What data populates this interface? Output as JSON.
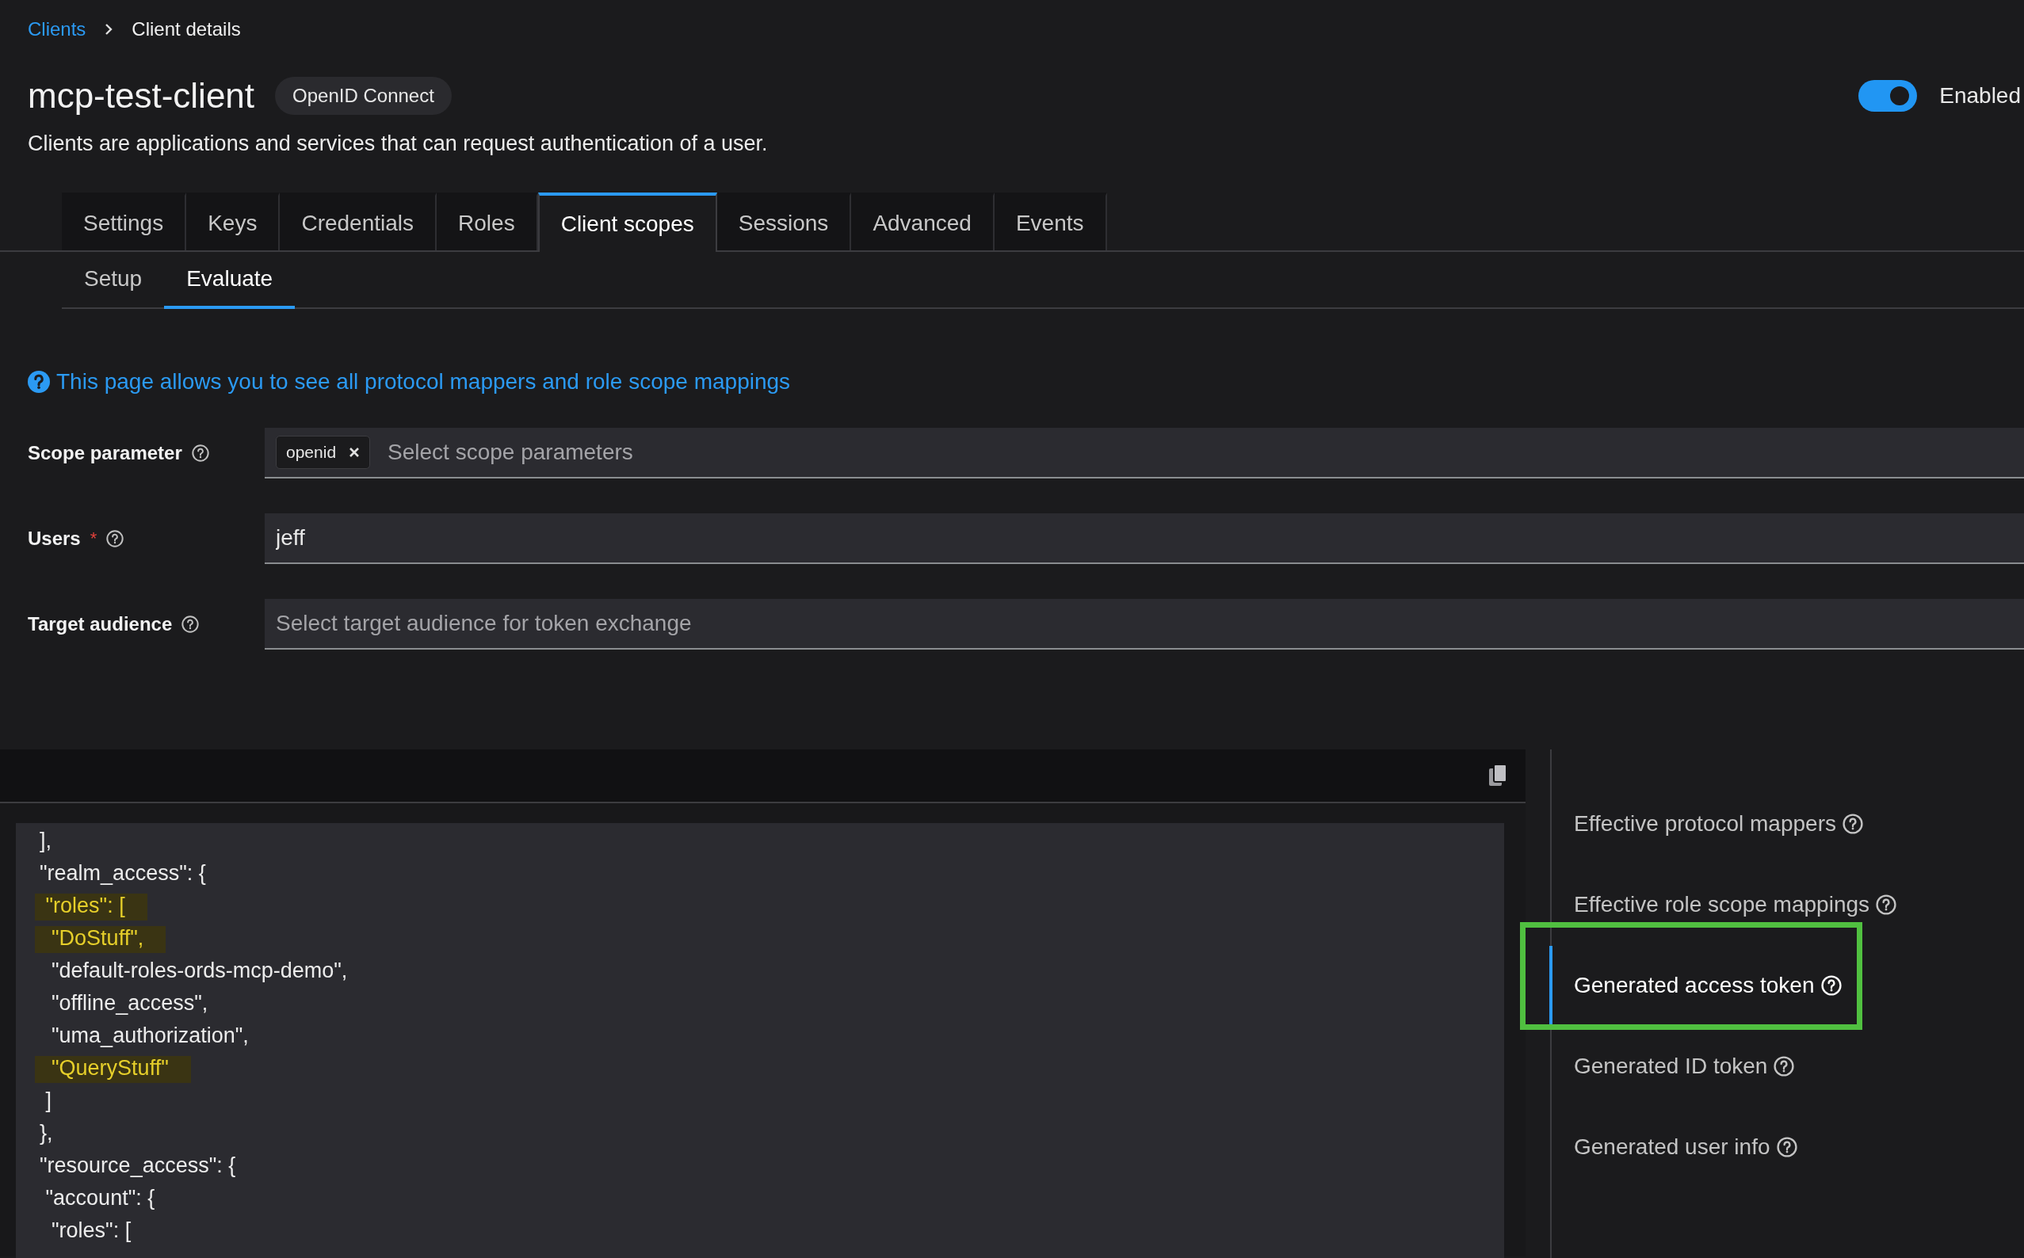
{
  "breadcrumb": [
    {
      "label": "Clients",
      "kind": "link"
    },
    {
      "label": "Client details",
      "kind": "current"
    }
  ],
  "header": {
    "title": "mcp-test-client",
    "badge": "OpenID Connect",
    "description": "Clients are applications and services that can request authentication of a user.",
    "toggle": {
      "on": true,
      "label": "Enabled"
    }
  },
  "tabs": [
    {
      "label": "Settings",
      "selected": false
    },
    {
      "label": "Keys",
      "selected": false
    },
    {
      "label": "Credentials",
      "selected": false
    },
    {
      "label": "Roles",
      "selected": false
    },
    {
      "label": "Client scopes",
      "selected": true
    },
    {
      "label": "Sessions",
      "selected": false
    },
    {
      "label": "Advanced",
      "selected": false
    },
    {
      "label": "Events",
      "selected": false
    }
  ],
  "subtabs": [
    {
      "label": "Setup",
      "selected": false
    },
    {
      "label": "Evaluate",
      "selected": true
    }
  ],
  "info": "This page allows you to see all protocol mappers and role scope mappings",
  "form": [
    {
      "label": "Scope parameter",
      "kind": "chips",
      "chips": [
        "openid"
      ],
      "placeholder": "Select scope parameters"
    },
    {
      "label": "Users",
      "required_mark": "*",
      "kind": "text",
      "value": "jeff"
    },
    {
      "label": "Target audience",
      "kind": "text",
      "placeholder": "Select target audience for token exchange"
    }
  ],
  "code_lines": [
    {
      "text": "],",
      "highlighted": false
    },
    {
      "text": "\"realm_access\": {",
      "highlighted": false
    },
    {
      "text": " \"roles\": [",
      "highlighted": true
    },
    {
      "text": "  \"DoStuff\",",
      "highlighted": true
    },
    {
      "text": "  \"default-roles-ords-mcp-demo\",",
      "highlighted": false
    },
    {
      "text": "  \"offline_access\",",
      "highlighted": false
    },
    {
      "text": "  \"uma_authorization\",",
      "highlighted": false
    },
    {
      "text": "  \"QueryStuff\"",
      "highlighted": true
    },
    {
      "text": " ]",
      "highlighted": false
    },
    {
      "text": "},",
      "highlighted": false
    },
    {
      "text": "\"resource_access\": {",
      "highlighted": false
    },
    {
      "text": " \"account\": {",
      "highlighted": false
    },
    {
      "text": "  \"roles\": [",
      "highlighted": false
    }
  ],
  "side_nav": [
    {
      "label": "Effective protocol mappers",
      "selected": false,
      "outlined": false
    },
    {
      "label": "Effective role scope mappings",
      "selected": false,
      "outlined": false
    },
    {
      "label": "Generated access token",
      "selected": true,
      "outlined": true
    },
    {
      "label": "Generated ID token",
      "selected": false,
      "outlined": false
    },
    {
      "label": "Generated user info",
      "selected": false,
      "outlined": false
    }
  ]
}
